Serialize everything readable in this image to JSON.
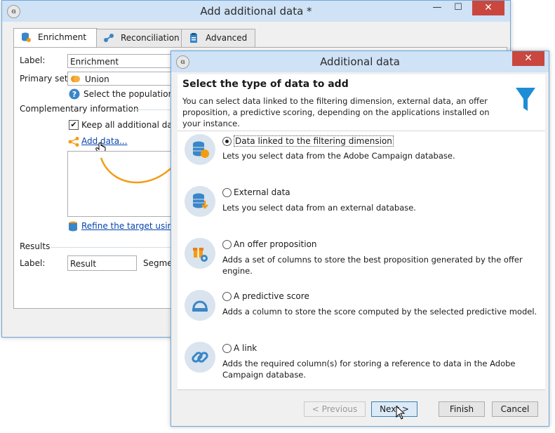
{
  "main_window": {
    "title": "Add additional data *",
    "tabs": [
      {
        "label": "Enrichment",
        "icon": "enrichment-icon",
        "active": true
      },
      {
        "label": "Reconciliation",
        "icon": "reconciliation-icon",
        "active": false
      },
      {
        "label": "Advanced",
        "icon": "clipboard-icon",
        "active": false
      }
    ],
    "label_caption": "Label:",
    "label_value": "Enrichment",
    "primary_set_caption": "Primary set:",
    "primary_set_value": "Union",
    "population_hint": "Select the population wh",
    "complementary_title": "Complementary information",
    "keep_all_label": "Keep all additional data f",
    "add_data_link": "Add data...",
    "refine_link": "Refine the target using a",
    "results_title": "Results",
    "results_label_caption": "Label:",
    "results_label_value": "Result",
    "segment_caption": "Segmen"
  },
  "dialog": {
    "title": "Additional data",
    "header_title": "Select the type of data to add",
    "header_description": "You can select data linked to the filtering dimension, external data, an offer proposition, a predictive scoring, depending on the applications installed on your instance.",
    "options": [
      {
        "label": "Data linked to the filtering dimension",
        "description": "Lets you select data from the Adobe Campaign database.",
        "selected": true,
        "icon": "database-link-icon"
      },
      {
        "label": "External data",
        "description": "Lets you select data from an external database.",
        "selected": false,
        "icon": "external-database-icon"
      },
      {
        "label": "An offer proposition",
        "description": "Adds a set of columns to store the best proposition generated by the offer engine.",
        "selected": false,
        "icon": "offer-gear-icon"
      },
      {
        "label": "A predictive score",
        "description": "Adds a column to store the score computed by the selected predictive model.",
        "selected": false,
        "icon": "predictive-score-icon"
      },
      {
        "label": "A link",
        "description": "Adds the required column(s) for storing a reference to data in the Adobe Campaign database.",
        "selected": false,
        "icon": "link-chain-icon"
      }
    ],
    "buttons": {
      "previous": "< Previous",
      "next": "Next >",
      "finish": "Finish",
      "cancel": "Cancel"
    }
  },
  "colors": {
    "title_bar": "#cfe2f6",
    "close_button": "#c9473e",
    "accent_orange": "#f39c12",
    "funnel_blue": "#1f8dd6",
    "link_blue": "#0645ad"
  }
}
